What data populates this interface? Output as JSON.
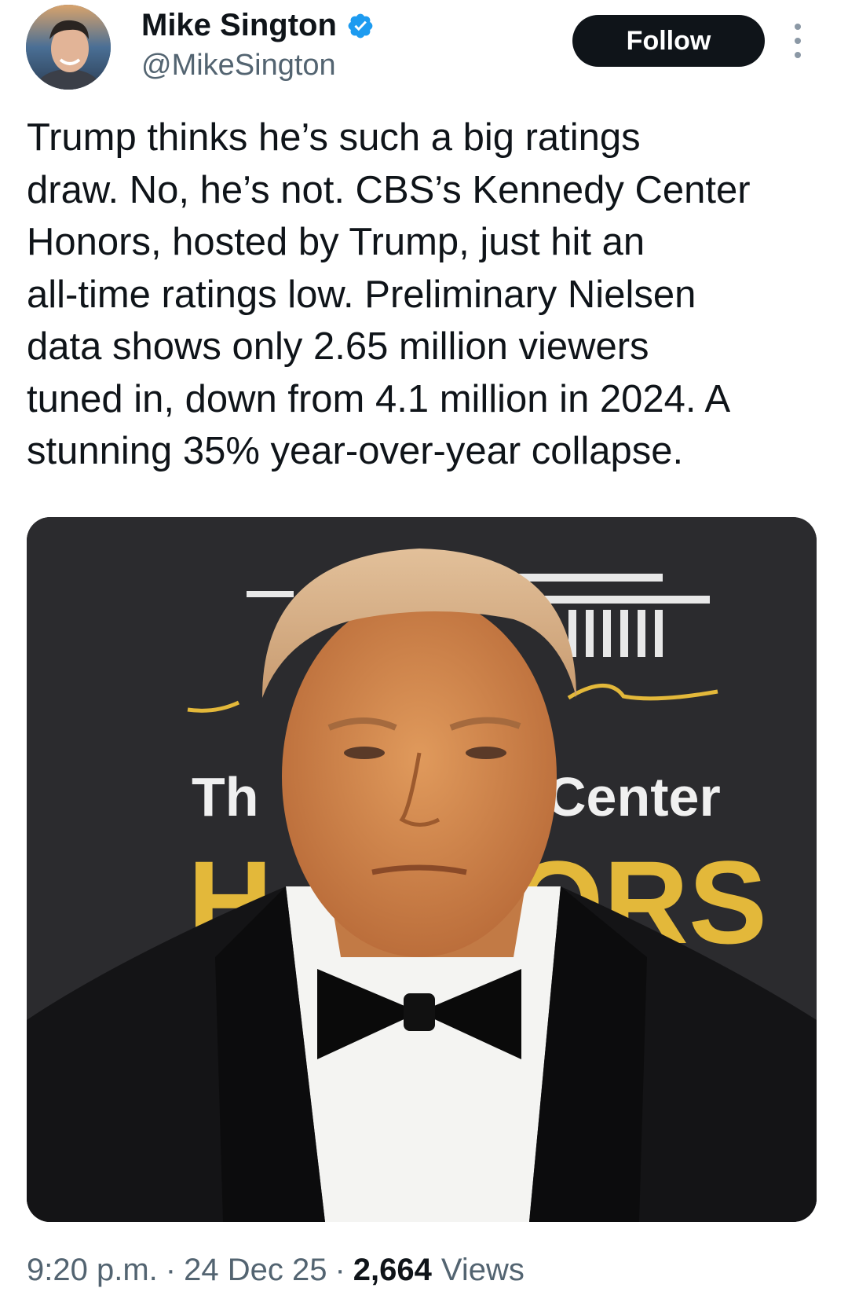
{
  "author": {
    "name": "Mike Sington",
    "handle": "@MikeSington",
    "verified": true
  },
  "actions": {
    "follow_label": "Follow",
    "more_icon": "more-vertical-icon"
  },
  "tweet": {
    "text": "Trump thinks he’s such a big ratings\ndraw. No, he’s not. CBS’s Kennedy Center\nHonors, hosted by Trump, just hit an\nall-time ratings low. Preliminary Nielsen\ndata shows only 2.65 million  viewers\ntuned in, down from 4.1 million in 2024. A\nstunning 35% year-over-year collapse."
  },
  "media": {
    "backdrop_text_left_top": "Th",
    "backdrop_text_right_top": "Center",
    "backdrop_text_left_bottom": "H",
    "backdrop_text_right_bottom": "ORS"
  },
  "meta": {
    "time": "9:20 p.m.",
    "separator": "·",
    "date": "24 Dec 25",
    "views_count": "2,664",
    "views_label": "Views"
  },
  "colors": {
    "follow_bg": "#0f1419",
    "verified_blue": "#1d9bf0",
    "secondary_text": "#536471",
    "honors_gold": "#e3b83a"
  }
}
